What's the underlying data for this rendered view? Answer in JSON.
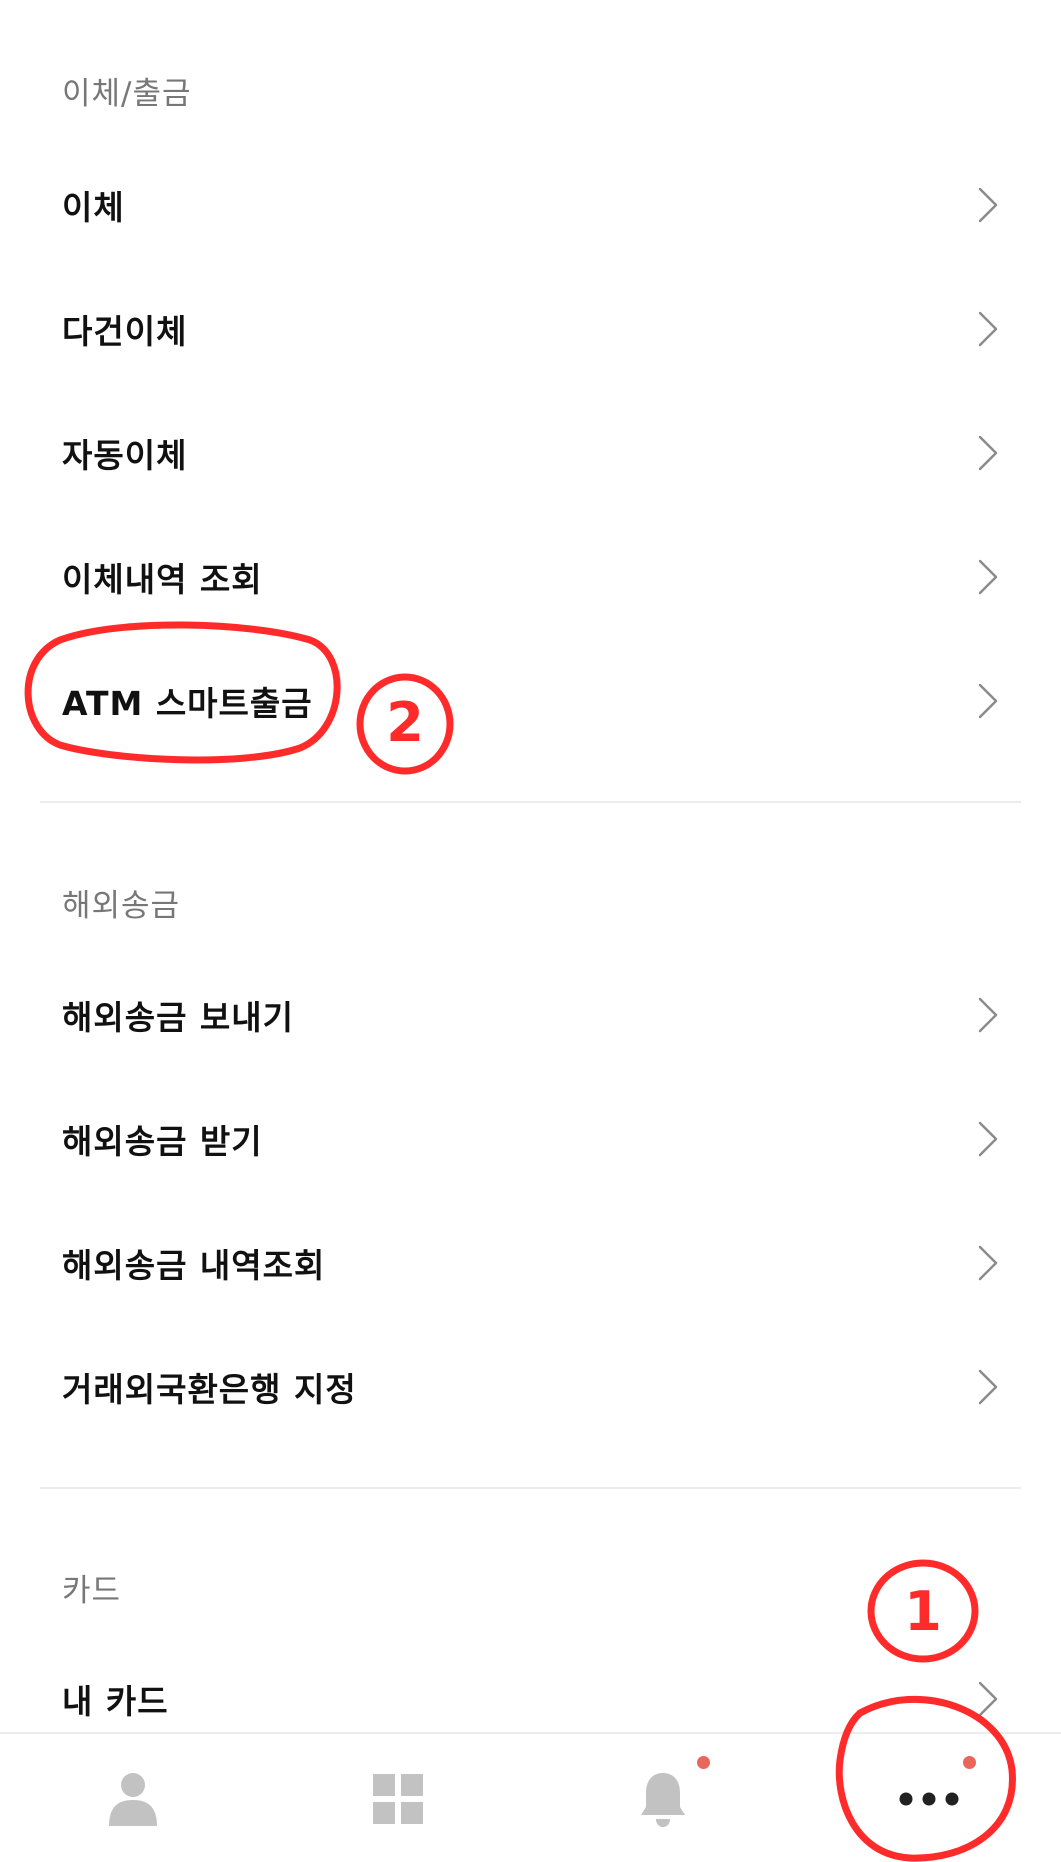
{
  "sections": [
    {
      "title": "이체/출금",
      "items": [
        "이체",
        "다건이체",
        "자동이체",
        "이체내역 조회",
        "ATM 스마트출금"
      ]
    },
    {
      "title": "해외송금",
      "items": [
        "해외송금 보내기",
        "해외송금 받기",
        "해외송금 내역조회",
        "거래외국환은행 지정"
      ]
    },
    {
      "title": "카드",
      "items": [
        "내 카드"
      ]
    }
  ],
  "bottom_nav": [
    {
      "icon": "person-icon"
    },
    {
      "icon": "grid-icon"
    },
    {
      "icon": "bell-icon",
      "badge": true
    },
    {
      "icon": "more-icon",
      "badge": true
    }
  ],
  "annotations": {
    "step_1": "1",
    "step_2": "2"
  },
  "colors": {
    "badge": "#e8675a",
    "annotation": "#ff2b2b",
    "icon_gray": "#c2c2c2",
    "label": "#111111",
    "section_title": "#777777"
  }
}
